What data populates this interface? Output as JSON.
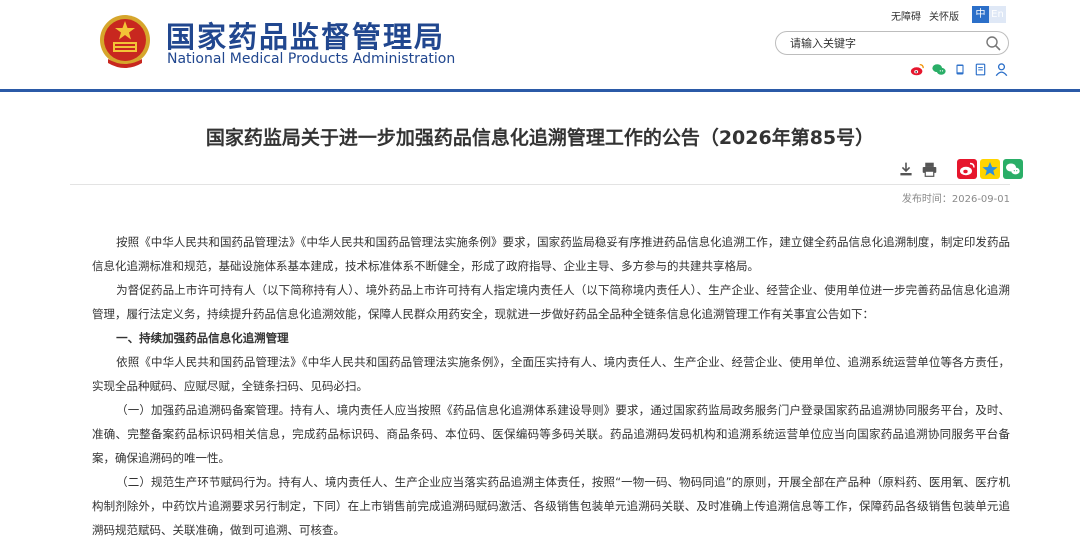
{
  "site": {
    "name_cn": "国家药品监督管理局",
    "name_en": "National Medical Products Administration"
  },
  "top_links": {
    "accessibility": "无障碍",
    "care_mode": "关怀版"
  },
  "language": {
    "zh": "中",
    "en": "En"
  },
  "search": {
    "placeholder": "请输入关键字"
  },
  "social_icons": [
    "weibo-icon",
    "wechat-icon",
    "mobile-icon",
    "email-icon",
    "user-icon"
  ],
  "article": {
    "title": "国家药监局关于进一步加强药品信息化追溯管理工作的公告（2026年第85号）",
    "publish_time": "发布时间：2026-09-01",
    "paragraphs": [
      "按照《中华人民共和国药品管理法》《中华人民共和国药品管理法实施条例》要求，国家药监局稳妥有序推进药品信息化追溯工作，建立健全药品信息化追溯制度，制定印发药品信息化追溯标准和规范，基础设施体系基本建成，技术标准体系不断健全，形成了政府指导、企业主导、多方参与的共建共享格局。",
      "为督促药品上市许可持有人（以下简称持有人）、境外药品上市许可持有人指定境内责任人（以下简称境内责任人）、生产企业、经营企业、使用单位进一步完善药品信息化追溯管理，履行法定义务，持续提升药品信息化追溯效能，保障人民群众用药安全，现就进一步做好药品全品种全链条信息化追溯管理工作有关事宜公告如下：",
      "一、持续加强药品信息化追溯管理",
      "依照《中华人民共和国药品管理法》《中华人民共和国药品管理法实施条例》，全面压实持有人、境内责任人、生产企业、经营企业、使用单位、追溯系统运营单位等各方责任，实现全品种赋码、应赋尽赋，全链条扫码、见码必扫。",
      "（一）加强药品追溯码备案管理。持有人、境内责任人应当按照《药品信息化追溯体系建设导则》要求，通过国家药监局政务服务门户登录国家药品追溯协同服务平台，及时、准确、完整备案药品标识码相关信息，完成药品标识码、商品条码、本位码、医保编码等多码关联。药品追溯码发码机构和追溯系统运营单位应当向国家药品追溯协同服务平台备案，确保追溯码的唯一性。",
      "（二）规范生产环节赋码行为。持有人、境内责任人、生产企业应当落实药品追溯主体责任，按照“一物一码、物码同追”的原则，开展全部在产品种（原料药、医用氧、医疗机构制剂除外，中药饮片追溯要求另行制定，下同）在上市销售前完成追溯码赋码激活、各级销售包装单元追溯码关联、及时准确上传追溯信息等工作，保障药品各级销售包装单元追溯码规范赋码、关联准确，做到可追溯、可核查。"
    ]
  },
  "tool_icons": [
    "download-icon",
    "print-icon",
    "share-weibo-icon",
    "share-qzone-icon",
    "share-wechat-icon"
  ],
  "colors": {
    "brand_blue": "#21478f",
    "header_bar": "#2b5aa7",
    "lang_active": "#2b6fc9"
  }
}
